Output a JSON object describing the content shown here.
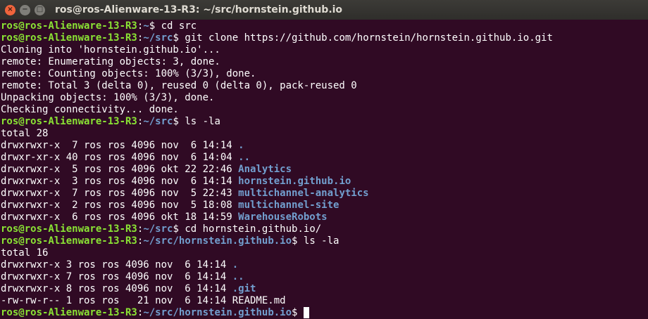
{
  "window": {
    "title": "ros@ros-Alienware-13-R3: ~/src/hornstein.github.io",
    "buttons": {
      "close": "×",
      "minimize": "−",
      "maximize": "□"
    }
  },
  "terminal": {
    "lines": [
      [
        {
          "t": "ros@ros-Alienware-13-R3",
          "c": "u"
        },
        {
          "t": ":"
        },
        {
          "t": "~",
          "c": "p"
        },
        {
          "t": "$ cd src"
        }
      ],
      [
        {
          "t": "ros@ros-Alienware-13-R3",
          "c": "u"
        },
        {
          "t": ":"
        },
        {
          "t": "~/src",
          "c": "p"
        },
        {
          "t": "$ git clone https://github.com/hornstein/hornstein.github.io.git"
        }
      ],
      [
        {
          "t": "Cloning into 'hornstein.github.io'..."
        }
      ],
      [
        {
          "t": "remote: Enumerating objects: 3, done."
        }
      ],
      [
        {
          "t": "remote: Counting objects: 100% (3/3), done."
        }
      ],
      [
        {
          "t": "remote: Total 3 (delta 0), reused 0 (delta 0), pack-reused 0"
        }
      ],
      [
        {
          "t": "Unpacking objects: 100% (3/3), done."
        }
      ],
      [
        {
          "t": "Checking connectivity... done."
        }
      ],
      [
        {
          "t": "ros@ros-Alienware-13-R3",
          "c": "u"
        },
        {
          "t": ":"
        },
        {
          "t": "~/src",
          "c": "p"
        },
        {
          "t": "$ ls -la"
        }
      ],
      [
        {
          "t": "total 28"
        }
      ],
      [
        {
          "t": "drwxrwxr-x  7 ros ros 4096 nov  6 14:14 "
        },
        {
          "t": ".",
          "c": "d"
        }
      ],
      [
        {
          "t": "drwxr-xr-x 40 ros ros 4096 nov  6 14:04 "
        },
        {
          "t": "..",
          "c": "d"
        }
      ],
      [
        {
          "t": "drwxrwxr-x  5 ros ros 4096 okt 22 22:46 "
        },
        {
          "t": "Analytics",
          "c": "d"
        }
      ],
      [
        {
          "t": "drwxrwxr-x  3 ros ros 4096 nov  6 14:14 "
        },
        {
          "t": "hornstein.github.io",
          "c": "d"
        }
      ],
      [
        {
          "t": "drwxrwxr-x  7 ros ros 4096 nov  5 22:43 "
        },
        {
          "t": "multichannel-analytics",
          "c": "d"
        }
      ],
      [
        {
          "t": "drwxrwxr-x  2 ros ros 4096 nov  5 18:08 "
        },
        {
          "t": "multichannel-site",
          "c": "d"
        }
      ],
      [
        {
          "t": "drwxrwxr-x  6 ros ros 4096 okt 18 14:59 "
        },
        {
          "t": "WarehouseRobots",
          "c": "d"
        }
      ],
      [
        {
          "t": "ros@ros-Alienware-13-R3",
          "c": "u"
        },
        {
          "t": ":"
        },
        {
          "t": "~/src",
          "c": "p"
        },
        {
          "t": "$ cd hornstein.github.io/"
        }
      ],
      [
        {
          "t": "ros@ros-Alienware-13-R3",
          "c": "u"
        },
        {
          "t": ":"
        },
        {
          "t": "~/src/hornstein.github.io",
          "c": "p"
        },
        {
          "t": "$ ls -la"
        }
      ],
      [
        {
          "t": "total 16"
        }
      ],
      [
        {
          "t": "drwxrwxr-x 3 ros ros 4096 nov  6 14:14 "
        },
        {
          "t": ".",
          "c": "d"
        }
      ],
      [
        {
          "t": "drwxrwxr-x 7 ros ros 4096 nov  6 14:14 "
        },
        {
          "t": "..",
          "c": "d"
        }
      ],
      [
        {
          "t": "drwxrwxr-x 8 ros ros 4096 nov  6 14:14 "
        },
        {
          "t": ".git",
          "c": "d"
        }
      ],
      [
        {
          "t": "-rw-rw-r-- 1 ros ros   21 nov  6 14:14 README.md"
        }
      ],
      [
        {
          "t": "ros@ros-Alienware-13-R3",
          "c": "u"
        },
        {
          "t": ":"
        },
        {
          "t": "~/src/hornstein.github.io",
          "c": "p"
        },
        {
          "t": "$ "
        }
      ]
    ]
  }
}
